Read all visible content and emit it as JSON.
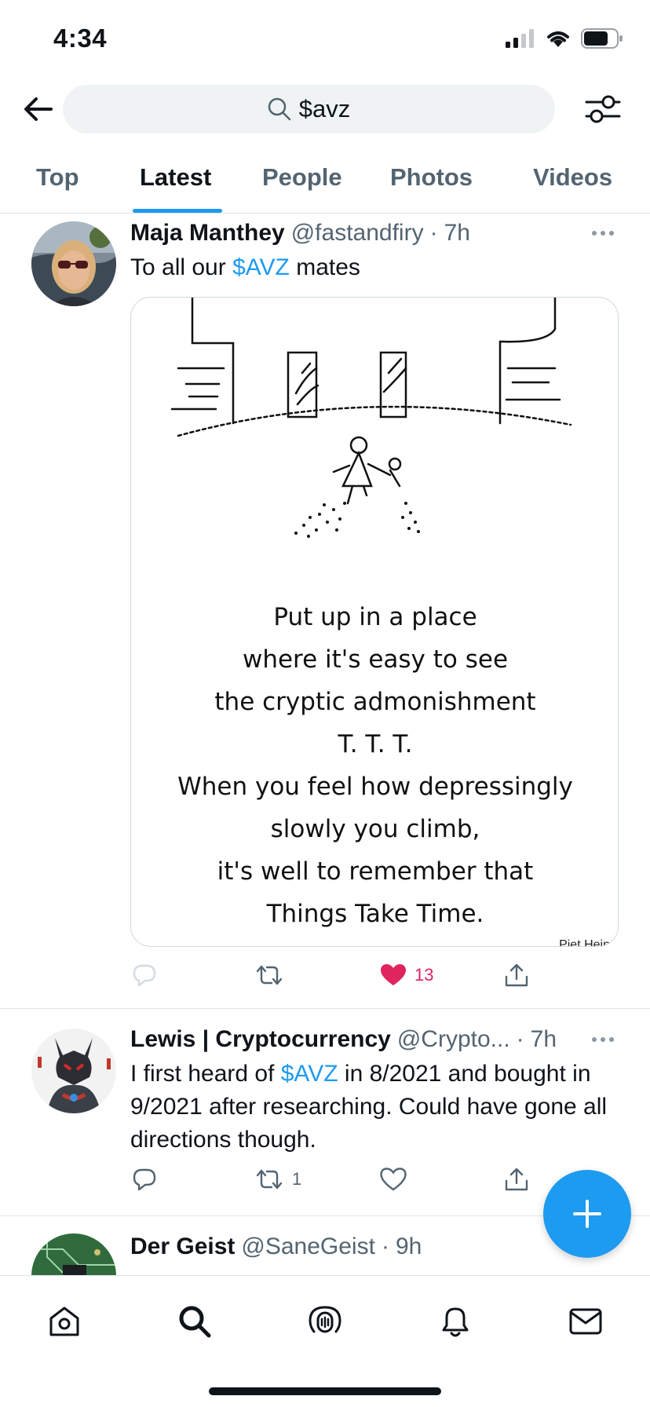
{
  "status_bar": {
    "time": "4:34",
    "battery_icon": "battery-icon",
    "wifi_icon": "wifi-icon",
    "signal_icon": "cellular-signal-icon"
  },
  "header": {
    "search_value": "$avz",
    "back_icon": "arrow-left-icon",
    "search_icon": "search-icon",
    "filter_icon": "sliders-icon"
  },
  "tabs": [
    {
      "label": "Top"
    },
    {
      "label": "Latest",
      "active": true
    },
    {
      "label": "People"
    },
    {
      "label": "Photos"
    },
    {
      "label": "Videos"
    }
  ],
  "tweets": [
    {
      "name": "Maja Manthey",
      "handle": "@fastandfiry",
      "separator": "·",
      "time": "7h",
      "text_before": "To all our ",
      "tag": "$AVZ",
      "text_after": " mates",
      "media": {
        "poem_lines": [
          "Put up in a place",
          "where it's easy to see",
          "the cryptic admonishment",
          "T. T. T.",
          "When you feel how depressingly",
          "slowly you climb,",
          "it's well to remember that",
          "Things Take Time."
        ],
        "signature": "Piet Hein"
      },
      "actions": {
        "reply_count": "",
        "retweet_count": "",
        "like_count": "13",
        "liked": true
      }
    },
    {
      "name": "Lewis | Cryptocurrency",
      "handle": "@Crypto...",
      "separator": "·",
      "time": "7h",
      "text_before": "I first heard of ",
      "tag": "$AVZ",
      "text_after": " in 8/2021 and bought in 9/2021 after researching. Could have gone all directions though.",
      "actions": {
        "reply_count": "",
        "retweet_count": "1",
        "like_count": ""
      }
    },
    {
      "name": "Der Geist",
      "handle": "@SaneGeist",
      "separator": "·",
      "time": "9h"
    }
  ],
  "fab": {
    "icon": "plus-icon"
  },
  "bottom_nav": [
    "home-icon",
    "search-icon",
    "spaces-icon",
    "notifications-bell-icon",
    "messages-envelope-icon"
  ],
  "colors": {
    "accent": "#1d9bf0",
    "like": "#e0245e",
    "secondary_text": "#536471"
  }
}
